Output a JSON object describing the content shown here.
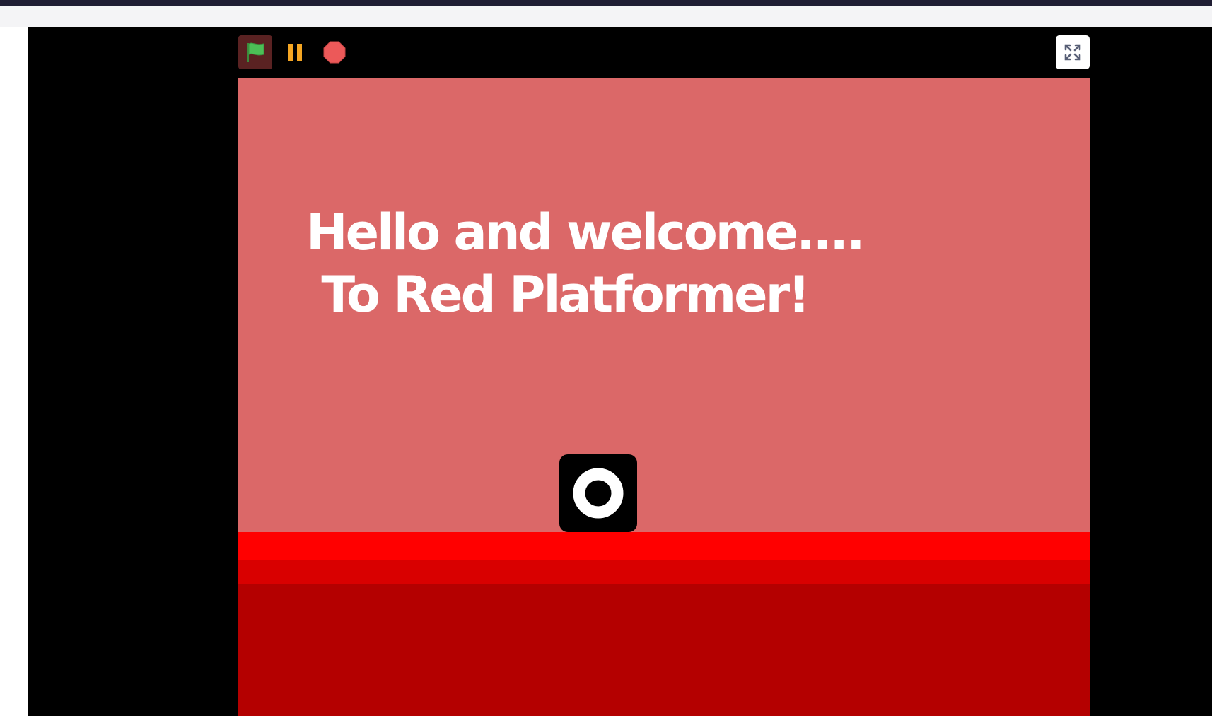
{
  "window": {
    "accent_color": "#1f1d33"
  },
  "controls": {
    "green_flag_icon": "green-flag-icon",
    "pause_icon": "pause-icon",
    "stop_icon": "stop-icon",
    "fullscreen_icon": "fullscreen-icon"
  },
  "stage": {
    "title_line1": "Hello and welcome....",
    "title_line2": " To Red Platformer!",
    "background_color": "#db6868",
    "ground_colors": [
      "#ff0000",
      "#d90000",
      "#b40000"
    ]
  },
  "player": {
    "sprite_icon": "ring-icon",
    "color": "#000000"
  }
}
